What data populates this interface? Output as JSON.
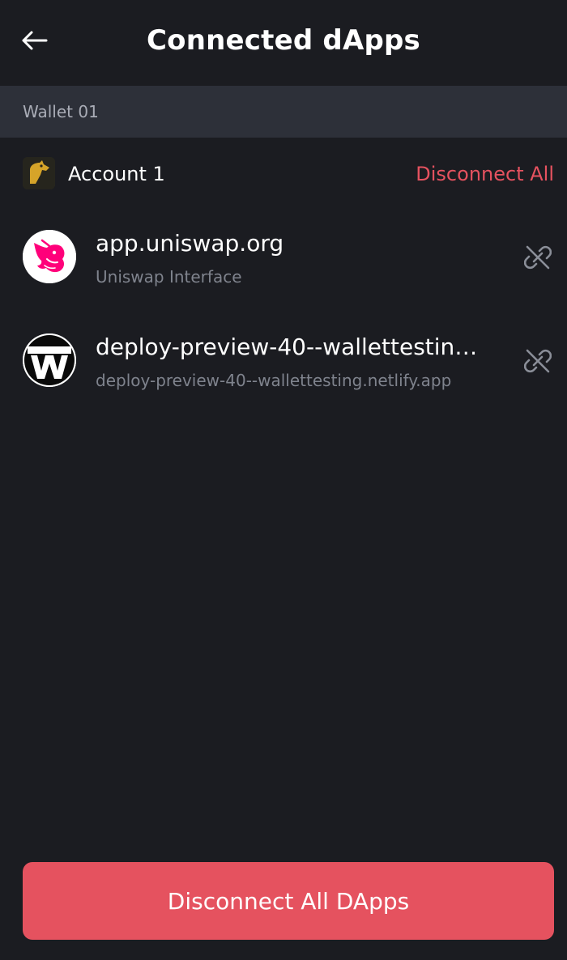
{
  "header": {
    "title": "Connected dApps",
    "back_icon": "arrow-left-icon"
  },
  "wallet": {
    "label": "Wallet 01"
  },
  "account": {
    "name": "Account 1",
    "avatar_icon": "account-avatar-icon",
    "disconnect_all_label": "Disconnect All"
  },
  "dapps": [
    {
      "name": "app.uniswap.org",
      "subtitle": "Uniswap Interface",
      "logo_icon": "uniswap-logo-icon",
      "action_icon": "unlink-icon"
    },
    {
      "name": "deploy-preview-40--wallettesting.netlify.app",
      "subtitle": "deploy-preview-40--wallettesting.netlify.app",
      "logo_icon": "wallettesting-logo-icon",
      "action_icon": "unlink-icon"
    }
  ],
  "footer": {
    "button_label": "Disconnect All DApps"
  },
  "colors": {
    "background": "#1b1c21",
    "section_header": "#2d3039",
    "accent_red": "#e5525f",
    "muted_text": "#7f838d",
    "uniswap_pink": "#ff007a"
  }
}
